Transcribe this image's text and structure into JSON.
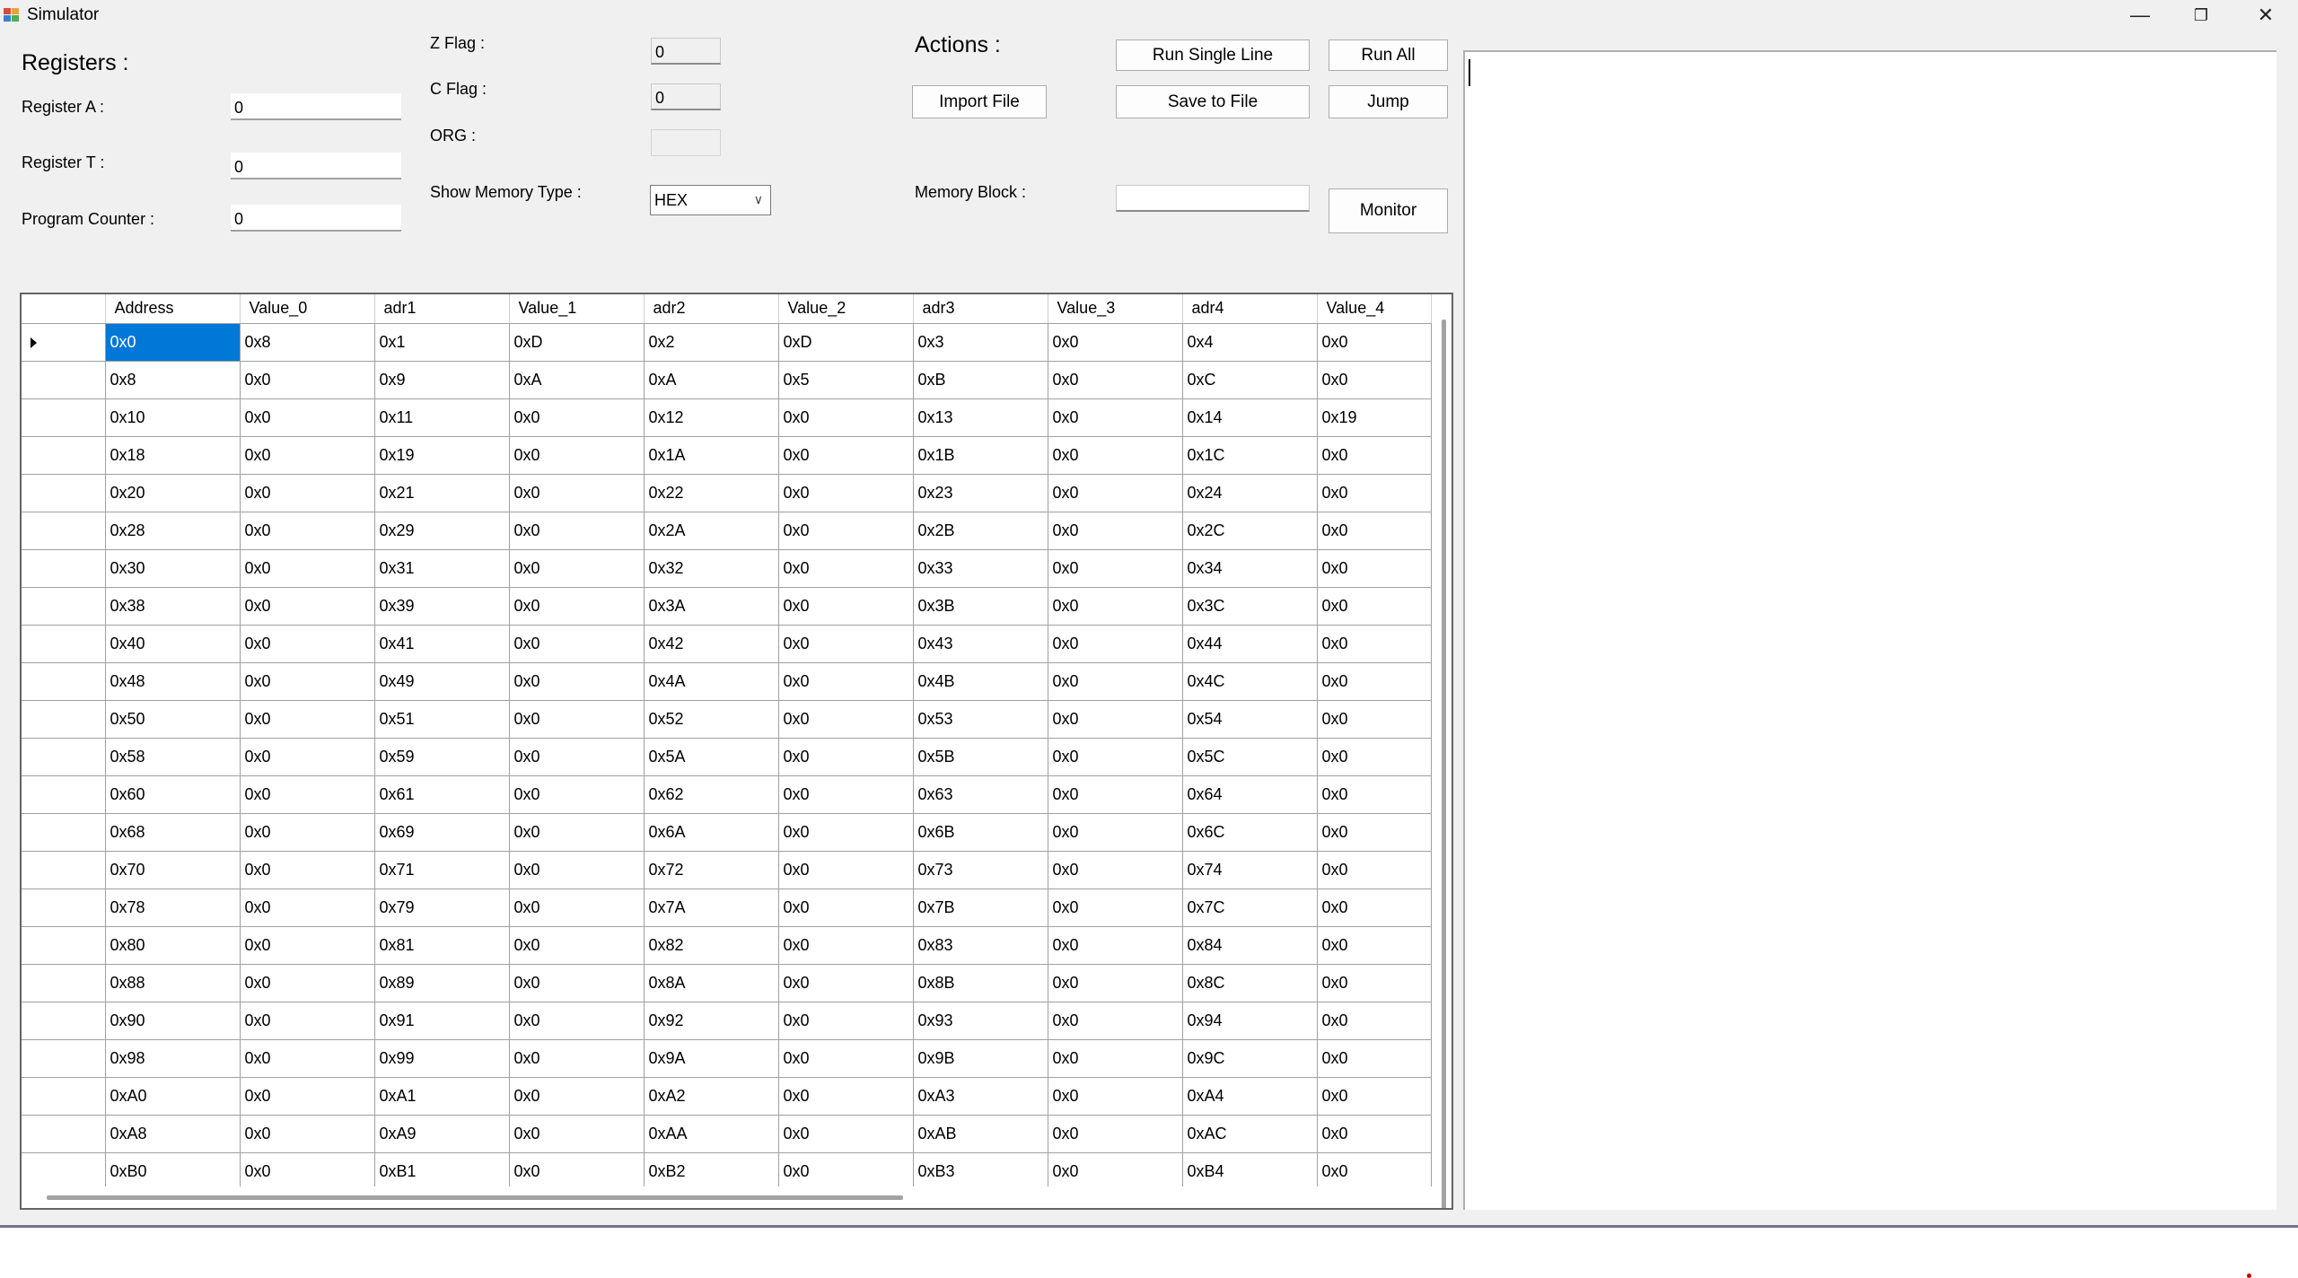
{
  "window": {
    "title": "Simulator",
    "controls": {
      "minimize": "—",
      "restore": "❐",
      "close": "✕"
    }
  },
  "registers": {
    "heading": "Registers :",
    "register_a_label": "Register A :",
    "register_a_value": "0",
    "register_t_label": "Register T :",
    "register_t_value": "0",
    "program_counter_label": "Program Counter :",
    "program_counter_value": "0"
  },
  "flags": {
    "z_flag_label": "Z Flag :",
    "z_flag_value": "0",
    "c_flag_label": "C Flag :",
    "c_flag_value": "0",
    "org_label": "ORG :",
    "org_value": "",
    "memory_type_label": "Show Memory Type :",
    "memory_type_selected": "HEX"
  },
  "actions": {
    "heading": "Actions :",
    "run_single_line": "Run Single Line",
    "run_all": "Run All",
    "import_file": "Import File",
    "save_to_file": "Save to File",
    "jump": "Jump",
    "memory_block_label": "Memory Block :",
    "memory_block_value": "",
    "monitor": "Monitor"
  },
  "memory_grid": {
    "columns": [
      "Address",
      "Value_0",
      "adr1",
      "Value_1",
      "adr2",
      "Value_2",
      "adr3",
      "Value_3",
      "adr4",
      "Value_4"
    ],
    "selected_row": 0,
    "rows": [
      [
        "0x0",
        "0x8",
        "0x1",
        "0xD",
        "0x2",
        "0xD",
        "0x3",
        "0x0",
        "0x4",
        "0x0"
      ],
      [
        "0x8",
        "0x0",
        "0x9",
        "0xA",
        "0xA",
        "0x5",
        "0xB",
        "0x0",
        "0xC",
        "0x0"
      ],
      [
        "0x10",
        "0x0",
        "0x11",
        "0x0",
        "0x12",
        "0x0",
        "0x13",
        "0x0",
        "0x14",
        "0x19"
      ],
      [
        "0x18",
        "0x0",
        "0x19",
        "0x0",
        "0x1A",
        "0x0",
        "0x1B",
        "0x0",
        "0x1C",
        "0x0"
      ],
      [
        "0x20",
        "0x0",
        "0x21",
        "0x0",
        "0x22",
        "0x0",
        "0x23",
        "0x0",
        "0x24",
        "0x0"
      ],
      [
        "0x28",
        "0x0",
        "0x29",
        "0x0",
        "0x2A",
        "0x0",
        "0x2B",
        "0x0",
        "0x2C",
        "0x0"
      ],
      [
        "0x30",
        "0x0",
        "0x31",
        "0x0",
        "0x32",
        "0x0",
        "0x33",
        "0x0",
        "0x34",
        "0x0"
      ],
      [
        "0x38",
        "0x0",
        "0x39",
        "0x0",
        "0x3A",
        "0x0",
        "0x3B",
        "0x0",
        "0x3C",
        "0x0"
      ],
      [
        "0x40",
        "0x0",
        "0x41",
        "0x0",
        "0x42",
        "0x0",
        "0x43",
        "0x0",
        "0x44",
        "0x0"
      ],
      [
        "0x48",
        "0x0",
        "0x49",
        "0x0",
        "0x4A",
        "0x0",
        "0x4B",
        "0x0",
        "0x4C",
        "0x0"
      ],
      [
        "0x50",
        "0x0",
        "0x51",
        "0x0",
        "0x52",
        "0x0",
        "0x53",
        "0x0",
        "0x54",
        "0x0"
      ],
      [
        "0x58",
        "0x0",
        "0x59",
        "0x0",
        "0x5A",
        "0x0",
        "0x5B",
        "0x0",
        "0x5C",
        "0x0"
      ],
      [
        "0x60",
        "0x0",
        "0x61",
        "0x0",
        "0x62",
        "0x0",
        "0x63",
        "0x0",
        "0x64",
        "0x0"
      ],
      [
        "0x68",
        "0x0",
        "0x69",
        "0x0",
        "0x6A",
        "0x0",
        "0x6B",
        "0x0",
        "0x6C",
        "0x0"
      ],
      [
        "0x70",
        "0x0",
        "0x71",
        "0x0",
        "0x72",
        "0x0",
        "0x73",
        "0x0",
        "0x74",
        "0x0"
      ],
      [
        "0x78",
        "0x0",
        "0x79",
        "0x0",
        "0x7A",
        "0x0",
        "0x7B",
        "0x0",
        "0x7C",
        "0x0"
      ],
      [
        "0x80",
        "0x0",
        "0x81",
        "0x0",
        "0x82",
        "0x0",
        "0x83",
        "0x0",
        "0x84",
        "0x0"
      ],
      [
        "0x88",
        "0x0",
        "0x89",
        "0x0",
        "0x8A",
        "0x0",
        "0x8B",
        "0x0",
        "0x8C",
        "0x0"
      ],
      [
        "0x90",
        "0x0",
        "0x91",
        "0x0",
        "0x92",
        "0x0",
        "0x93",
        "0x0",
        "0x94",
        "0x0"
      ],
      [
        "0x98",
        "0x0",
        "0x99",
        "0x0",
        "0x9A",
        "0x0",
        "0x9B",
        "0x0",
        "0x9C",
        "0x0"
      ],
      [
        "0xA0",
        "0x0",
        "0xA1",
        "0x0",
        "0xA2",
        "0x0",
        "0xA3",
        "0x0",
        "0xA4",
        "0x0"
      ],
      [
        "0xA8",
        "0x0",
        "0xA9",
        "0x0",
        "0xAA",
        "0x0",
        "0xAB",
        "0x0",
        "0xAC",
        "0x0"
      ],
      [
        "0xB0",
        "0x0",
        "0xB1",
        "0x0",
        "0xB2",
        "0x0",
        "0xB3",
        "0x0",
        "0xB4",
        "0x0"
      ]
    ]
  },
  "output": {
    "text": ""
  },
  "colors": {
    "selection": "#0078d7",
    "window_bg": "#f0f0f0"
  }
}
